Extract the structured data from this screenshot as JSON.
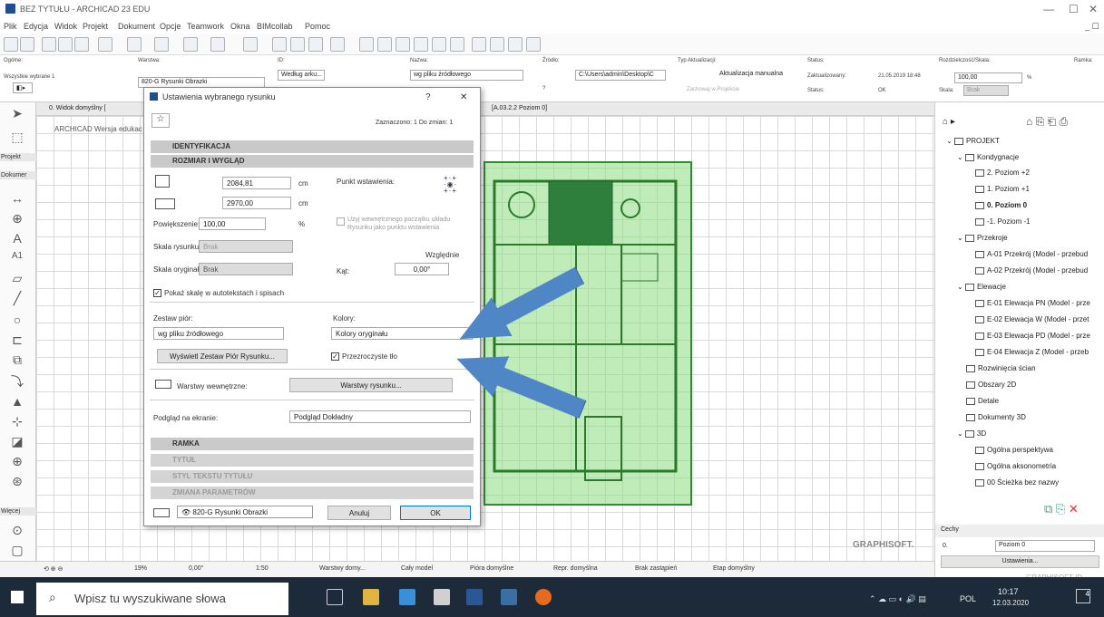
{
  "window": {
    "title": "BEZ TYTUŁU - ARCHICAD 23 EDU"
  },
  "menu": [
    "Plik",
    "Edycja",
    "Widok",
    "Projekt",
    "Dokument",
    "Opcje",
    "Teamwork",
    "Okna",
    "BIMcollab",
    "Pomoc"
  ],
  "infobox": {
    "ogolne_label": "Ogólne:",
    "ogolne_value": "Wszystkie wybrane 1",
    "warstwa_label": "Warstwa:",
    "warstwa_value": "820-G Rysunki Obrazki",
    "id_label": "ID:",
    "id_value": "Według arku...",
    "nazwa_label": "Nazwa:",
    "nazwa_value": "wg pliku źródłowego",
    "zrodlo_label": "Źródło:",
    "zrodlo_value": "C:\\Users\\admin\\Desktop\\C",
    "typ_label": "Typ Aktualizacji:",
    "typ_value": "Aktualizacja manualna",
    "zachowaj": "Zachowaj w Projekcie",
    "status_label": "Status:",
    "status1": "Zaktualizowany:",
    "date": "21.05.2019 18:48",
    "status2": "Status:",
    "ok": "OK",
    "skala_label": "Rozdzielczość/Skala:",
    "skala_value": "100,00",
    "pct": "%",
    "skala2_label": "Skala:",
    "skala2_value": "Brak",
    "ramka_label": "Ramka:",
    "question": "?"
  },
  "sidebar": {
    "projekt": "Projekt",
    "dokument": "Dokumer",
    "wiecej": "Więcej",
    "a1": "A1"
  },
  "tabs": {
    "view": "0. Widok domyślny [",
    "plan": "[A.03.2.2 Poziom 0]"
  },
  "canvas": {
    "edu_text": "ARCHICAD Wersja edukac",
    "graphisoft": "GRAPHISOFT."
  },
  "dialog": {
    "title": "Ustawienia wybranego rysunku",
    "help": "?",
    "close": "✕",
    "selected": "Zaznaczono: 1 Do zmian: 1",
    "sec_identyfikacja": "IDENTYFIKACJA",
    "sec_rozmiar": "ROZMIAR I WYGLĄD",
    "width": "2084,81",
    "height": "2970,00",
    "unit": "cm",
    "punkt": "Punkt wstawienia:",
    "powiekszenie_label": "Powiększenie:",
    "powiekszenie": "100,00",
    "pct": "%",
    "uzyj": "Użyj wewnętrznego początku układu",
    "uzyj2": "Rysunku jako punktu wstawienia",
    "skala_label": "Skala rysunku:",
    "skala": "Brak",
    "wzglednie": "Względnie",
    "skala_org_label": "Skala oryginału:",
    "skala_org": "Brak",
    "kat_label": "Kąt:",
    "kat": "0,00°",
    "pokaz": "Pokaż skalę w autotekstach i spisach",
    "zestaw_label": "Zestaw piór:",
    "zestaw": "wg pliku źródłowego",
    "kolory_label": "Kolory:",
    "kolory": "Kolory oryginału",
    "wyswietl": "Wyświetl Zestaw Piór Rysunku...",
    "przezroczyste": "Przezroczyste tło",
    "warstwy_label": "Warstwy wewnętrzne:",
    "warstwy_btn": "Warstwy rysunku...",
    "podglad_label": "Podgląd na ekranie:",
    "podglad": "Podgląd Dokładny",
    "sec_ramka": "RAMKA",
    "sec_tytul": "TYTUŁ",
    "sec_styl": "STYL TEKSTU TYTUŁU",
    "sec_zmiana": "ZMIANA PARAMETRÓW",
    "footer_layer": "820-G Rysunki Obrazki",
    "anuluj": "Anuluj",
    "ok": "OK"
  },
  "navigator": {
    "projekt": "PROJEKT",
    "kondygnacje": "Kondygnacje",
    "stories": [
      "2. Poziom +2",
      "1. Poziom +1",
      "0. Poziom 0",
      "-1. Poziom -1"
    ],
    "przekroje": "Przekroje",
    "sections": [
      "A-01 Przekrój (Model - przebud",
      "A-02 Przekrój (Model - przebud"
    ],
    "elewacje": "Elewacje",
    "elevations": [
      "E-01 Elewacja PN (Model - prze",
      "E-02 Elewacja W (Model - przet",
      "E-03 Elewacja PD (Model - prze",
      "E-04 Elewacja Z (Model - przeb"
    ],
    "rozwiniecia": "Rozwinięcia ścian",
    "obszary": "Obszary 2D",
    "detale": "Detale",
    "dokumenty": "Dokumenty 3D",
    "d3": "3D",
    "persp": "Ogólna perspektywa",
    "akso": "Ogólna aksonometria",
    "sciezka": "00 Ścieżka bez nazwy",
    "cechy": "Cechy",
    "cechy_id": "0.",
    "cechy_name": "Poziom 0",
    "ustawienia": "Ustawienia...",
    "graphisoft_id": "GRAPHISOFT ID"
  },
  "statusbar": {
    "zoom": "19%",
    "angle": "0,00°",
    "scale": "1:50",
    "warstwy": "Warstwy domy...",
    "model": "Cały model",
    "piora": "Pióra domyślne",
    "repr": "Repr. domyślna",
    "brak": "Brak zastąpień",
    "etap": "Etap domyślny"
  },
  "taskbar": {
    "search": "Wpisz tu wyszukiwane słowa",
    "lang": "POL",
    "time": "10:17",
    "date": "12.03.2020",
    "notif": "4"
  }
}
